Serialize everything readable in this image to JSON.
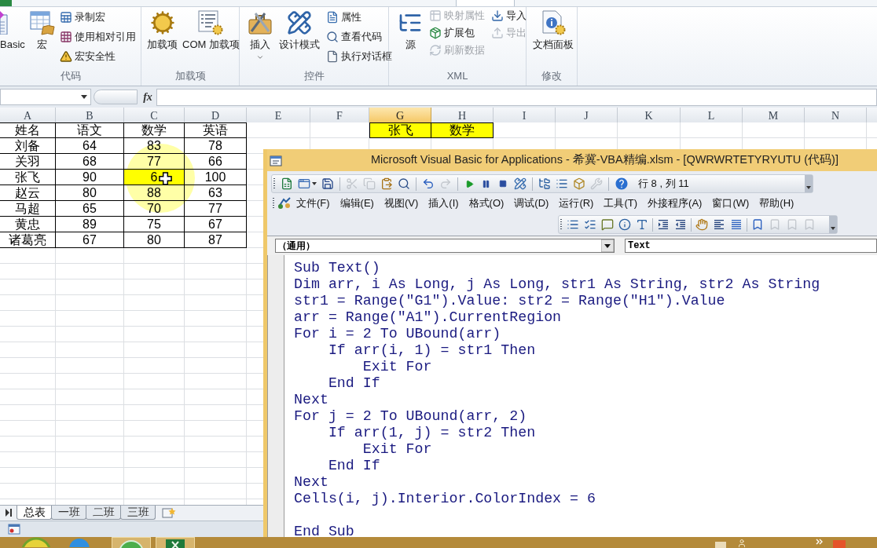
{
  "ribbon": {
    "groups": [
      {
        "label": "代码",
        "buttons": [
          {
            "label": "Basic",
            "kind": "large",
            "disabled": false
          },
          {
            "label": "宏",
            "kind": "large",
            "disabled": false
          },
          {
            "label": "录制宏",
            "kind": "small",
            "disabled": false
          },
          {
            "label": "使用相对引用",
            "kind": "small",
            "disabled": false
          },
          {
            "label": "宏安全性",
            "kind": "small",
            "disabled": false
          }
        ]
      },
      {
        "label": "加载项",
        "buttons": [
          {
            "label": "加载项",
            "kind": "large",
            "disabled": false
          },
          {
            "label": "COM 加载项",
            "kind": "large",
            "disabled": false
          }
        ]
      },
      {
        "label": "控件",
        "buttons": [
          {
            "label": "插入",
            "kind": "menu",
            "disabled": false
          },
          {
            "label": "设计模式",
            "kind": "large",
            "disabled": false
          },
          {
            "label": "属性",
            "kind": "small",
            "disabled": false
          },
          {
            "label": "查看代码",
            "kind": "small",
            "disabled": false
          },
          {
            "label": "执行对话框",
            "kind": "small",
            "disabled": false
          }
        ]
      },
      {
        "label": "XML",
        "buttons": [
          {
            "label": "源",
            "kind": "large",
            "disabled": false
          },
          {
            "label": "映射属性",
            "kind": "small",
            "disabled": true
          },
          {
            "label": "扩展包",
            "kind": "small",
            "disabled": false
          },
          {
            "label": "刷新数据",
            "kind": "small",
            "disabled": true
          },
          {
            "label": "导入",
            "kind": "small",
            "disabled": false
          },
          {
            "label": "导出",
            "kind": "small",
            "disabled": true
          }
        ]
      },
      {
        "label": "修改",
        "buttons": [
          {
            "label": "文档面板",
            "kind": "large",
            "disabled": false
          }
        ]
      }
    ]
  },
  "formula_bar": {
    "function_label": "fx"
  },
  "sheet": {
    "columns": [
      {
        "label": "A",
        "selected": false
      },
      {
        "label": "B",
        "selected": false
      },
      {
        "label": "C",
        "selected": false
      },
      {
        "label": "D",
        "selected": false
      },
      {
        "label": "E",
        "selected": false
      },
      {
        "label": "F",
        "selected": false
      },
      {
        "label": "G",
        "selected": true
      },
      {
        "label": "H",
        "selected": false
      },
      {
        "label": "I",
        "selected": false
      },
      {
        "label": "J",
        "selected": false
      },
      {
        "label": "K",
        "selected": false
      },
      {
        "label": "L",
        "selected": false
      },
      {
        "label": "M",
        "selected": false
      },
      {
        "label": "N",
        "selected": false
      }
    ],
    "table": {
      "header": [
        "姓名",
        "语文",
        "数学",
        "英语"
      ],
      "rows": [
        {
          "cells": [
            {
              "text": "刘备",
              "highlighted": false
            },
            {
              "text": "64",
              "highlighted": false
            },
            {
              "text": "83",
              "highlighted": false
            },
            {
              "text": "78",
              "highlighted": false
            }
          ]
        },
        {
          "cells": [
            {
              "text": "关羽",
              "highlighted": false
            },
            {
              "text": "68",
              "highlighted": false
            },
            {
              "text": "77",
              "highlighted": false
            },
            {
              "text": "66",
              "highlighted": false
            }
          ]
        },
        {
          "cells": [
            {
              "text": "张飞",
              "highlighted": false
            },
            {
              "text": "90",
              "highlighted": false
            },
            {
              "text": "6",
              "highlighted": true
            },
            {
              "text": "100",
              "highlighted": false
            }
          ]
        },
        {
          "cells": [
            {
              "text": "赵云",
              "highlighted": false
            },
            {
              "text": "80",
              "highlighted": false
            },
            {
              "text": "88",
              "highlighted": false
            },
            {
              "text": "63",
              "highlighted": false
            }
          ]
        },
        {
          "cells": [
            {
              "text": "马超",
              "highlighted": false
            },
            {
              "text": "65",
              "highlighted": false
            },
            {
              "text": "70",
              "highlighted": false
            },
            {
              "text": "77",
              "highlighted": false
            }
          ]
        },
        {
          "cells": [
            {
              "text": "黄忠",
              "highlighted": false
            },
            {
              "text": "89",
              "highlighted": false
            },
            {
              "text": "75",
              "highlighted": false
            },
            {
              "text": "67",
              "highlighted": false
            }
          ]
        },
        {
          "cells": [
            {
              "text": "诸葛亮",
              "highlighted": false
            },
            {
              "text": "67",
              "highlighted": false
            },
            {
              "text": "80",
              "highlighted": false
            },
            {
              "text": "87",
              "highlighted": false
            }
          ]
        }
      ]
    },
    "lookup_cells": [
      {
        "text": "张飞",
        "highlighted": true
      },
      {
        "text": "数学",
        "highlighted": true
      }
    ]
  },
  "sheet_tabs": [
    {
      "label": "总表",
      "selected": true
    },
    {
      "label": "一班",
      "selected": false
    },
    {
      "label": "二班",
      "selected": false
    },
    {
      "label": "三班",
      "selected": false
    }
  ],
  "vba_editor": {
    "title": "Microsoft Visual Basic for Applications - 希冀-VBA精编.xlsm - [QWRWRTETYRYUTU (代码)]",
    "standard_toolbar": [
      [
        {
          "kind": "excel",
          "disabled": false
        },
        {
          "kind": "userform",
          "disabled": false
        },
        {
          "kind": "save",
          "disabled": false
        }
      ],
      [
        {
          "kind": "cut",
          "disabled": true
        },
        {
          "kind": "copy",
          "disabled": true
        },
        {
          "kind": "paste",
          "disabled": false
        },
        {
          "kind": "find",
          "disabled": false
        }
      ],
      [
        {
          "kind": "undo",
          "disabled": false
        },
        {
          "kind": "redo",
          "disabled": true
        }
      ],
      [
        {
          "kind": "run",
          "disabled": false
        },
        {
          "kind": "pause",
          "disabled": false
        },
        {
          "kind": "reset",
          "disabled": false
        },
        {
          "kind": "design",
          "disabled": false
        }
      ],
      [
        {
          "kind": "explorer",
          "disabled": false
        },
        {
          "kind": "properties",
          "disabled": false
        },
        {
          "kind": "browser",
          "disabled": false
        },
        {
          "kind": "toolbox",
          "disabled": true
        }
      ],
      [
        {
          "kind": "help",
          "disabled": false
        }
      ]
    ],
    "position": "行 8 , 列 11",
    "menus": [
      "文件(F)",
      "编辑(E)",
      "视图(V)",
      "插入(I)",
      "格式(O)",
      "调试(D)",
      "运行(R)",
      "工具(T)",
      "外接程序(A)",
      "窗口(W)",
      "帮助(H)"
    ],
    "edit_toolbar": [
      [
        {
          "kind": "members",
          "disabled": false
        },
        {
          "kind": "constants",
          "disabled": false
        },
        {
          "kind": "info",
          "disabled": false
        },
        {
          "kind": "parameters",
          "disabled": false
        },
        {
          "kind": "complete",
          "disabled": false
        }
      ],
      [
        {
          "kind": "indent",
          "disabled": false
        },
        {
          "kind": "outdent",
          "disabled": false
        }
      ],
      [
        {
          "kind": "breakpoint",
          "disabled": false
        },
        {
          "kind": "comment",
          "disabled": false
        },
        {
          "kind": "uncomment",
          "disabled": false
        }
      ],
      [
        {
          "kind": "bookmark",
          "disabled": false
        },
        {
          "kind": "next",
          "disabled": true
        },
        {
          "kind": "previous",
          "disabled": true
        },
        {
          "kind": "clear",
          "disabled": true
        }
      ]
    ],
    "object_box": "（通用）",
    "procedure_box": "Text",
    "code": "Sub Text()\nDim arr, i As Long, j As Long, str1 As String, str2 As String\nstr1 = Range(\"G1\").Value: str2 = Range(\"H1\").Value\narr = Range(\"A1\").CurrentRegion\nFor i = 2 To UBound(arr)\n    If arr(i, 1) = str1 Then\n        Exit For\n    End If\nNext\nFor j = 2 To UBound(arr, 2)\n    If arr(1, j) = str2 Then\n        Exit For\n    End If\nNext\nCells(i, j).Interior.ColorIndex = 6\n\nEnd Sub"
  }
}
